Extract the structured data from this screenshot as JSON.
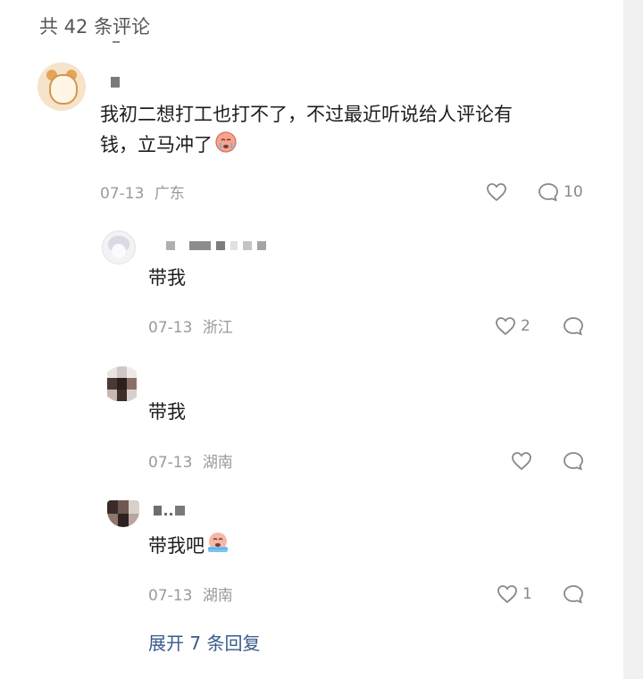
{
  "header": {
    "comment_count_label": "共 42 条评论"
  },
  "comments": [
    {
      "text_line1": "我初二想打工也打不了，不过最近听说给人评论有",
      "text_line2": "钱，立马冲了",
      "emoji": "crying-face-emoji",
      "date": "07-13",
      "location": "广东",
      "reply_count": "10"
    }
  ],
  "replies": [
    {
      "text": "带我",
      "date": "07-13",
      "location": "浙江",
      "like_count": "2"
    },
    {
      "text": "带我",
      "date": "07-13",
      "location": "湖南",
      "like_count": ""
    },
    {
      "text": "带我吧",
      "emoji": "crying-face-emoji",
      "date": "07-13",
      "location": "湖南",
      "like_count": "1"
    }
  ],
  "expand": {
    "label": "展开 7 条回复"
  },
  "colors": {
    "link": "#3a5a8c",
    "meta": "#9a9a9a",
    "text": "#1d1d1d"
  }
}
